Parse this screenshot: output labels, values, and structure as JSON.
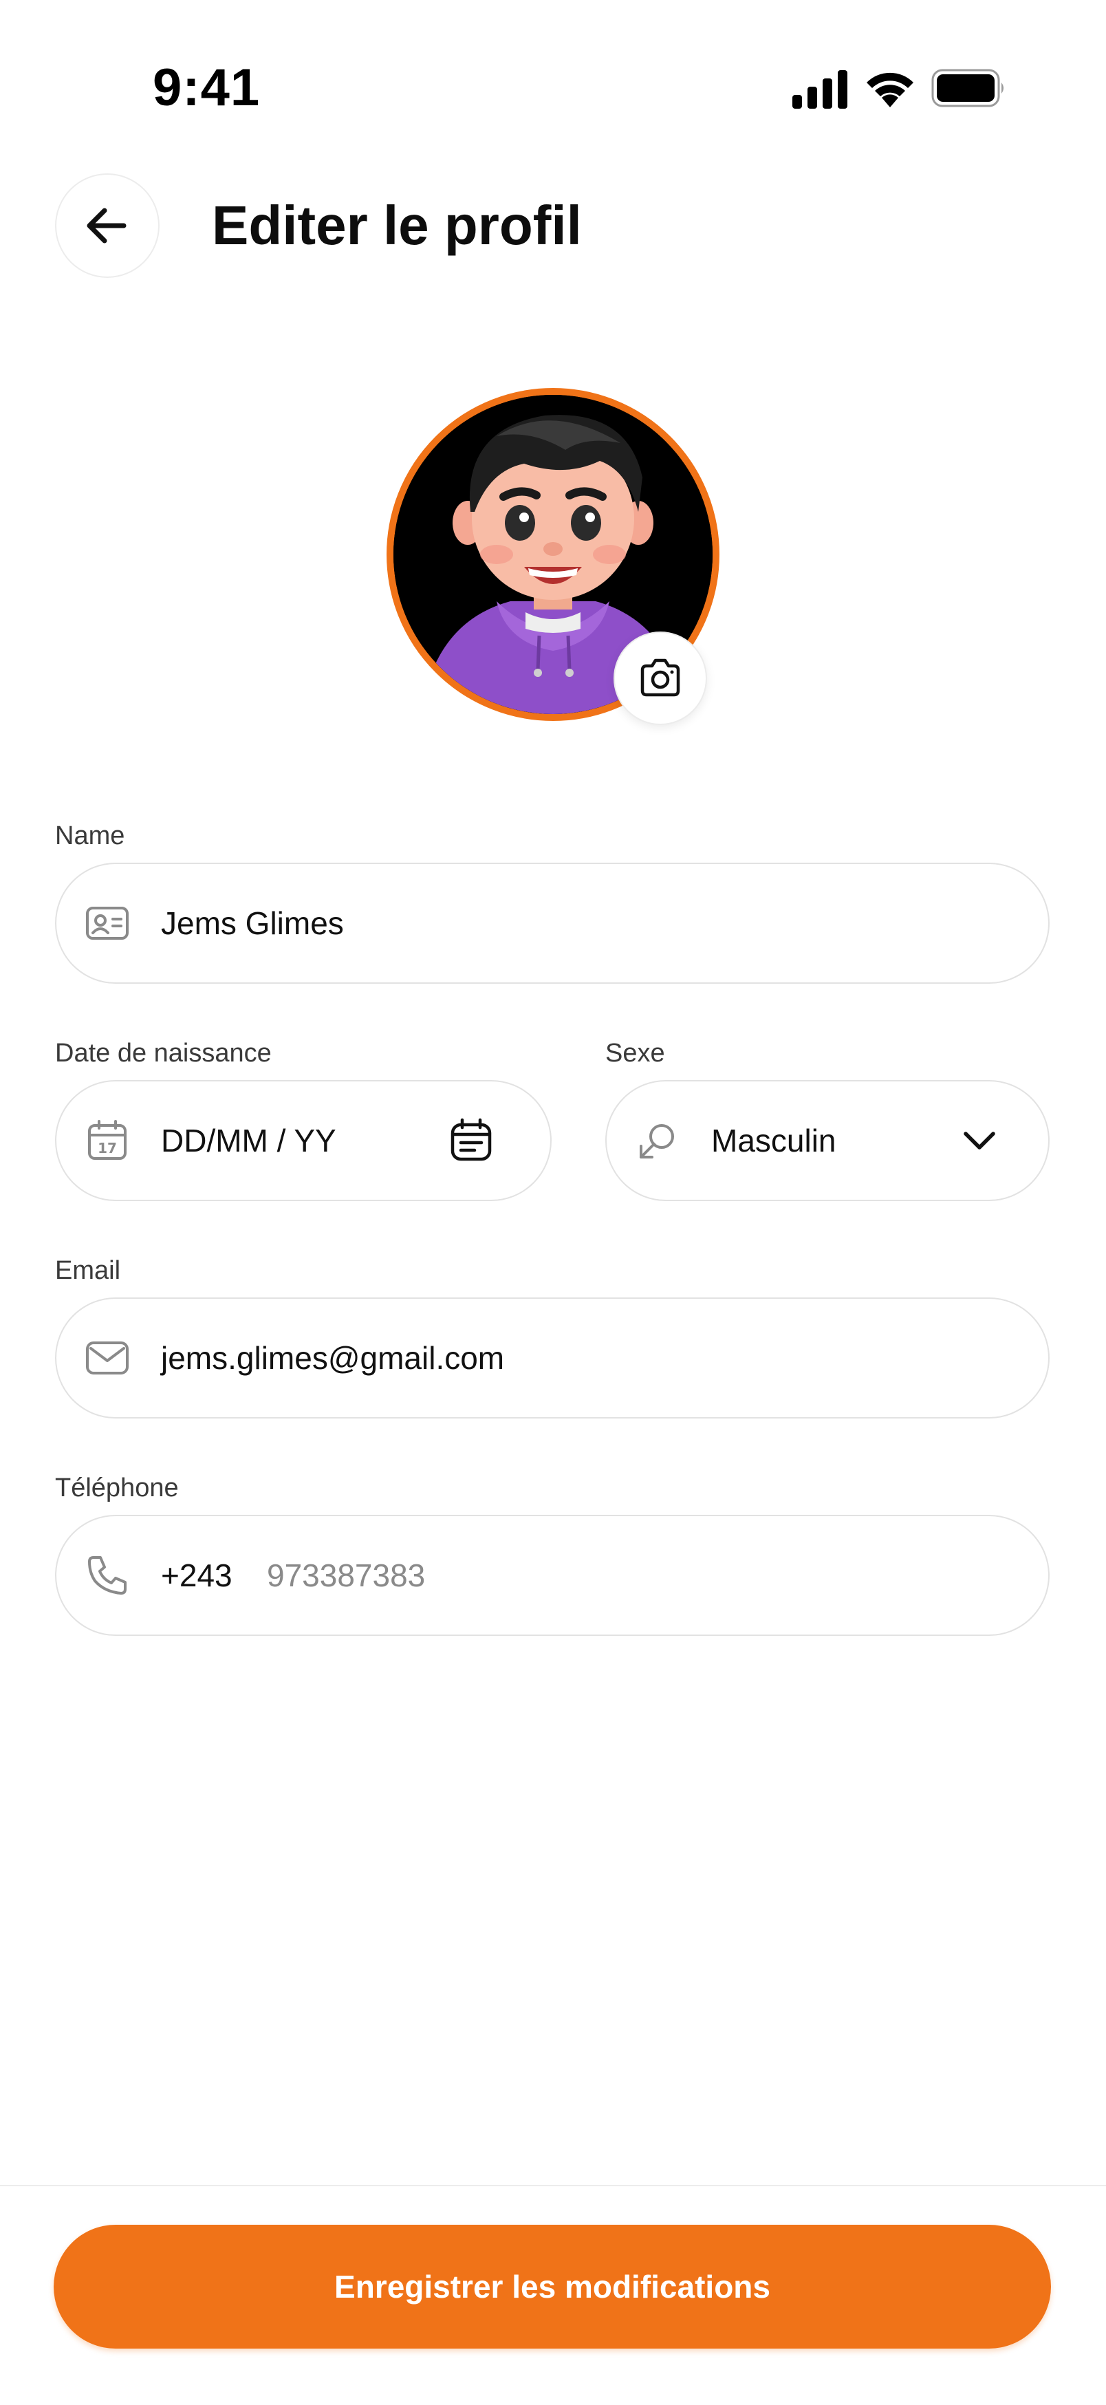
{
  "status_bar": {
    "time": "9:41"
  },
  "header": {
    "title": "Editer le profil",
    "back_icon": "arrow-left-icon"
  },
  "avatar": {
    "border_color": "#F07318",
    "camera_icon": "camera-icon"
  },
  "form": {
    "name": {
      "label": "Name",
      "value": "Jems Glimes",
      "icon": "id-card-icon"
    },
    "birth_date": {
      "label": "Date de naissance",
      "placeholder": "DD/MM / YY",
      "icon": "calendar-17-icon",
      "trailing_icon": "calendar-icon"
    },
    "gender": {
      "label": "Sexe",
      "value": "Masculin",
      "icon": "gender-male-icon",
      "trailing_icon": "chevron-down-icon"
    },
    "email": {
      "label": "Email",
      "value": "jems.glimes@gmail.com",
      "icon": "mail-icon"
    },
    "phone": {
      "label": "Téléphone",
      "country_code": "+243",
      "placeholder": "973387383",
      "icon": "phone-icon"
    }
  },
  "actions": {
    "save_label": "Enregistrer les modifications"
  },
  "colors": {
    "accent": "#F07318",
    "border": "#E2E2E2",
    "label": "#3A3A3A",
    "placeholder": "#8A8A8A"
  }
}
